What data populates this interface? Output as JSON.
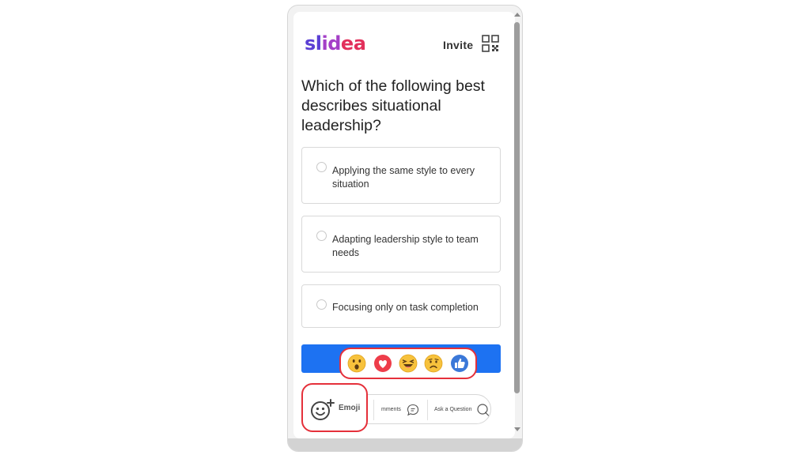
{
  "header": {
    "logo": {
      "part1": "sl",
      "part2": "id",
      "part3": "ea"
    },
    "invite_label": "Invite",
    "qr_icon": "qr-code-icon"
  },
  "question": "Which of the following best describes situational leadership?",
  "options": [
    {
      "label": "Applying the same style to every situation"
    },
    {
      "label": "Adapting leadership style to team needs"
    },
    {
      "label": "Focusing only on task completion"
    }
  ],
  "reactions": [
    {
      "icon": "surprised-emoji-icon"
    },
    {
      "icon": "heart-emoji-icon"
    },
    {
      "icon": "laughing-emoji-icon"
    },
    {
      "icon": "sad-emoji-icon"
    },
    {
      "icon": "thumbs-up-emoji-icon"
    }
  ],
  "action_bar": {
    "emoji_label": "Emoji",
    "comments_label": "mments",
    "ask_label": "Ask a Question"
  },
  "colors": {
    "brand_blue": "#1d72f2",
    "highlight_red": "#e5303a",
    "logo_purple": "#5b3fd4",
    "logo_red": "#e2305b"
  }
}
